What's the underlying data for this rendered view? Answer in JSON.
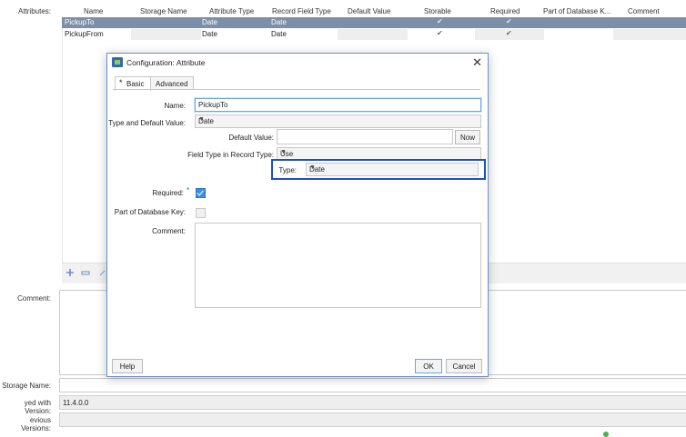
{
  "editor": {
    "attributes_label": "Attributes:",
    "comment_label": "Comment:",
    "storage_name_label": "Storage Name:",
    "saved_with_version_label": "yed with Version:",
    "saved_with_version_value": "11.4.0.0",
    "previous_versions_label": "evious Versions:",
    "columns": [
      "Name",
      "Storage Name",
      "Attribute Type",
      "Record Field Type",
      "Default Value",
      "Storable",
      "Required",
      "Part of Database K...",
      "Comment"
    ],
    "rows": [
      {
        "name": "PickupTo",
        "attribute_type": "Date",
        "record_field_type": "Date",
        "storable": "✔",
        "required": "✔"
      },
      {
        "name": "PickupFrom",
        "attribute_type": "Date",
        "record_field_type": "Date",
        "storable": "✔",
        "required": "✔"
      }
    ],
    "toolbar_icons": [
      "add-icon",
      "remove-icon",
      "edit-icon"
    ]
  },
  "dialog": {
    "title": "Configuration: Attribute",
    "close_glyph": "✕",
    "tabs": [
      {
        "star": "*",
        "label": "Basic",
        "active": true
      },
      {
        "label": "Advanced",
        "active": false
      }
    ],
    "name_label": "Name:",
    "name_value": "PickupTo",
    "type_default_label": "Type and Default Value:",
    "type_default_value": "Date",
    "default_value_label": "Default Value:",
    "default_value_value": "",
    "now_button": "Now",
    "field_type_label": "Field Type in Record Type:",
    "field_type_value": "Use",
    "type_label": "Type:",
    "type_value": "Date",
    "required_label": "Required:",
    "required_star": "*",
    "required_checked": true,
    "db_key_label": "Part of Database Key:",
    "db_key_checked": false,
    "comment_label": "Comment:",
    "comment_value": "",
    "help_button": "Help",
    "ok_button": "OK",
    "cancel_button": "Cancel",
    "dropdown_arrow": "▼"
  },
  "colors": {
    "selected_row": "#7d8fa8",
    "highlight_border": "#1a52c2",
    "focus_border": "#6aa6e0"
  }
}
